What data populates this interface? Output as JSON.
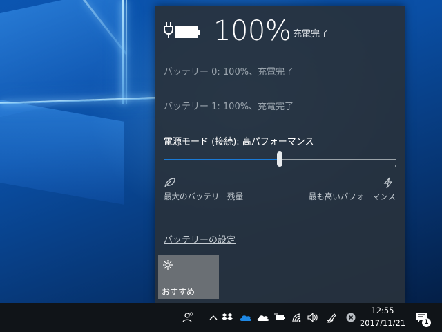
{
  "battery": {
    "percent_text": "100%",
    "status": "充電完了",
    "batteries": [
      "バッテリー 0: 100%、充電完了",
      "バッテリー 1: 100%、充電完了"
    ]
  },
  "power_mode": {
    "title": "電源モード (接続): 高パフォーマンス",
    "slider_level": 0.5,
    "left_label": "最大のバッテリー残量",
    "right_label": "最も高いパフォーマンス"
  },
  "settings_link": "バッテリーの設定",
  "tile": {
    "label": "おすすめ",
    "icon": "sun-icon"
  },
  "taskbar": {
    "time": "12:55",
    "date": "2017/11/21",
    "notification_count": "1",
    "tray_icons": [
      "people-icon",
      "chevron-up-icon",
      "dropbox-icon",
      "onedrive-blue-icon",
      "onedrive-white-icon",
      "battery-plugged-icon",
      "wifi-icon",
      "volume-icon",
      "pen-icon",
      "close-circle-icon"
    ]
  },
  "colors": {
    "accent": "#1a7ad6",
    "flyout_bg": "#283239",
    "taskbar_bg": "#101418",
    "tile_bg": "#6a6f74"
  }
}
